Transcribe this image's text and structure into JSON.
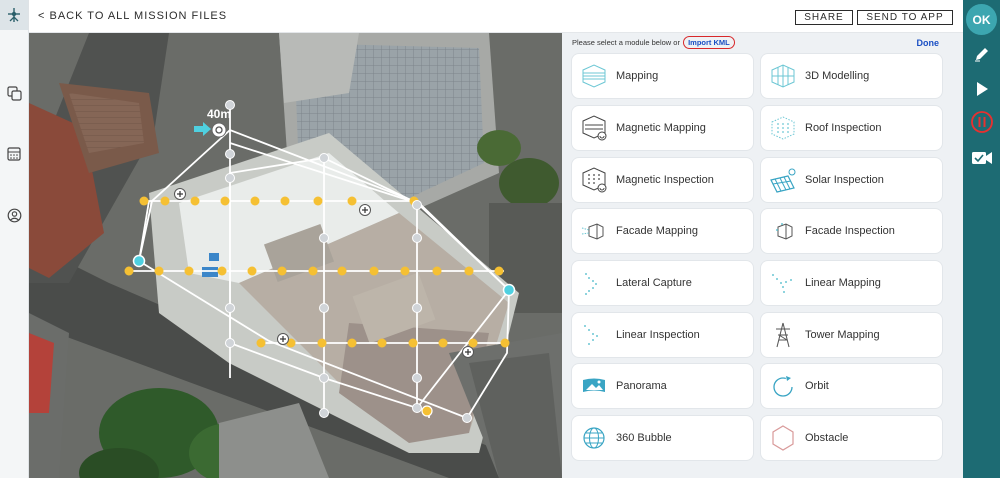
{
  "header": {
    "back_label": "< BACK TO ALL MISSION FILES",
    "share_label": "SHARE",
    "send_label": "SEND TO APP"
  },
  "left_rail": {
    "items": [
      {
        "icon": "waypoint-icon",
        "active": true
      },
      {
        "icon": "copy-icon",
        "active": false
      },
      {
        "icon": "calculator-icon",
        "active": false
      },
      {
        "icon": "user-icon",
        "active": false
      }
    ]
  },
  "map": {
    "altitude_label": "40m",
    "colors": {
      "path": "#ffffff",
      "waypoint": "#f5c033",
      "node": "#d0d4d8",
      "start": "#4fd0e0"
    }
  },
  "panel": {
    "prompt_text": "Please select a module below or",
    "import_label": "Import KML",
    "done_label": "Done",
    "modules": [
      {
        "label": "Mapping",
        "icon": "mapping-icon"
      },
      {
        "label": "3D Modelling",
        "icon": "3d-modelling-icon"
      },
      {
        "label": "Magnetic Mapping",
        "icon": "magnetic-mapping-icon"
      },
      {
        "label": "Roof Inspection",
        "icon": "roof-inspection-icon"
      },
      {
        "label": "Magnetic Inspection",
        "icon": "magnetic-inspection-icon"
      },
      {
        "label": "Solar Inspection",
        "icon": "solar-inspection-icon"
      },
      {
        "label": "Facade Mapping",
        "icon": "facade-mapping-icon"
      },
      {
        "label": "Facade Inspection",
        "icon": "facade-inspection-icon"
      },
      {
        "label": "Lateral Capture",
        "icon": "lateral-capture-icon"
      },
      {
        "label": "Linear Mapping",
        "icon": "linear-mapping-icon"
      },
      {
        "label": "Linear Inspection",
        "icon": "linear-inspection-icon"
      },
      {
        "label": "Tower Mapping",
        "icon": "tower-mapping-icon"
      },
      {
        "label": "Panorama",
        "icon": "panorama-icon"
      },
      {
        "label": "Orbit",
        "icon": "orbit-icon"
      },
      {
        "label": "360 Bubble",
        "icon": "360-bubble-icon"
      },
      {
        "label": "Obstacle",
        "icon": "obstacle-icon"
      }
    ]
  },
  "right_rail": {
    "ok_label": "OK",
    "tools": [
      {
        "icon": "pencil-icon"
      },
      {
        "icon": "play-icon"
      },
      {
        "icon": "pause-icon"
      },
      {
        "icon": "video-check-icon"
      }
    ],
    "pause_color": "#e8302f"
  }
}
